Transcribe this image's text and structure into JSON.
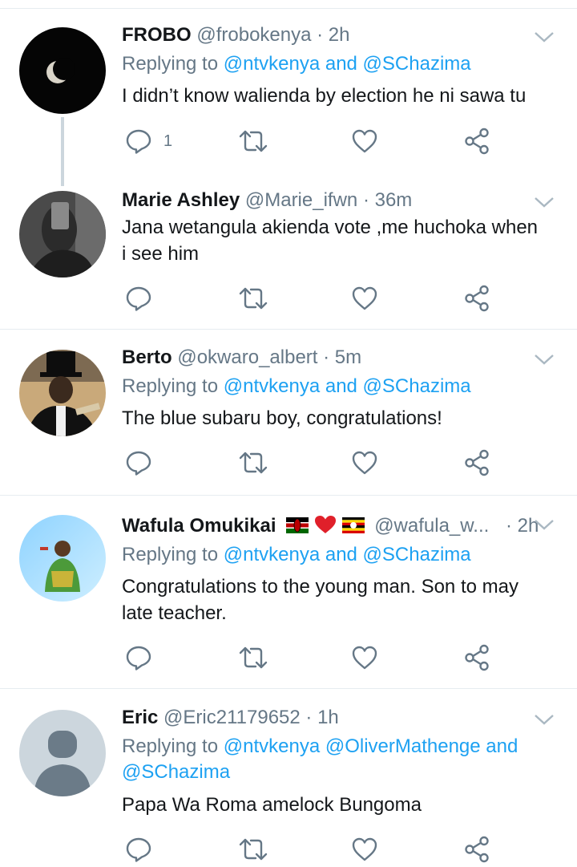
{
  "tweets": [
    {
      "name": "FROBO",
      "handle": "@frobokenya",
      "time": "· 2h",
      "reply_prefix": "Replying to ",
      "reply_mentions": "@ntvkenya and @SChazima",
      "text": "I didn’t know walienda by election he ni sawa tu",
      "reply_count": "1"
    },
    {
      "name": "Marie Ashley",
      "handle": "@Marie_ifwn",
      "time": "· 36m",
      "text_line1": "Jana wetangula akienda vote ,me huchoka when",
      "text_line2": "i see him"
    },
    {
      "name": "Berto",
      "handle": "@okwaro_albert",
      "time": "· 5m",
      "reply_prefix": "Replying to ",
      "reply_mentions": "@ntvkenya and @SChazima",
      "text": "The blue subaru boy, congratulations!"
    },
    {
      "name": "Wafula Omukikai",
      "handle": "@wafula_w...",
      "time": "· 2h",
      "reply_prefix": "Replying to ",
      "reply_mentions": "@ntvkenya and @SChazima",
      "text_line1": "Congratulations to the young man. Son to may",
      "text_line2": "late teacher."
    },
    {
      "name": "Eric",
      "handle": "@Eric21179652",
      "time": "· 1h",
      "reply_prefix": "Replying to ",
      "reply_mentions_line1": "@ntvkenya @OliverMathenge and",
      "reply_mentions_line2": "@SChazima",
      "text": "Papa Wa Roma amelock Bungoma"
    }
  ],
  "colors": {
    "accent": "#1da1f2",
    "secondary_text": "#657786",
    "primary_text": "#14171a",
    "divider": "#e6ecf0",
    "icon": "#657786"
  },
  "icons": [
    "reply-icon",
    "retweet-icon",
    "like-icon",
    "share-icon",
    "chevron-down-icon"
  ]
}
